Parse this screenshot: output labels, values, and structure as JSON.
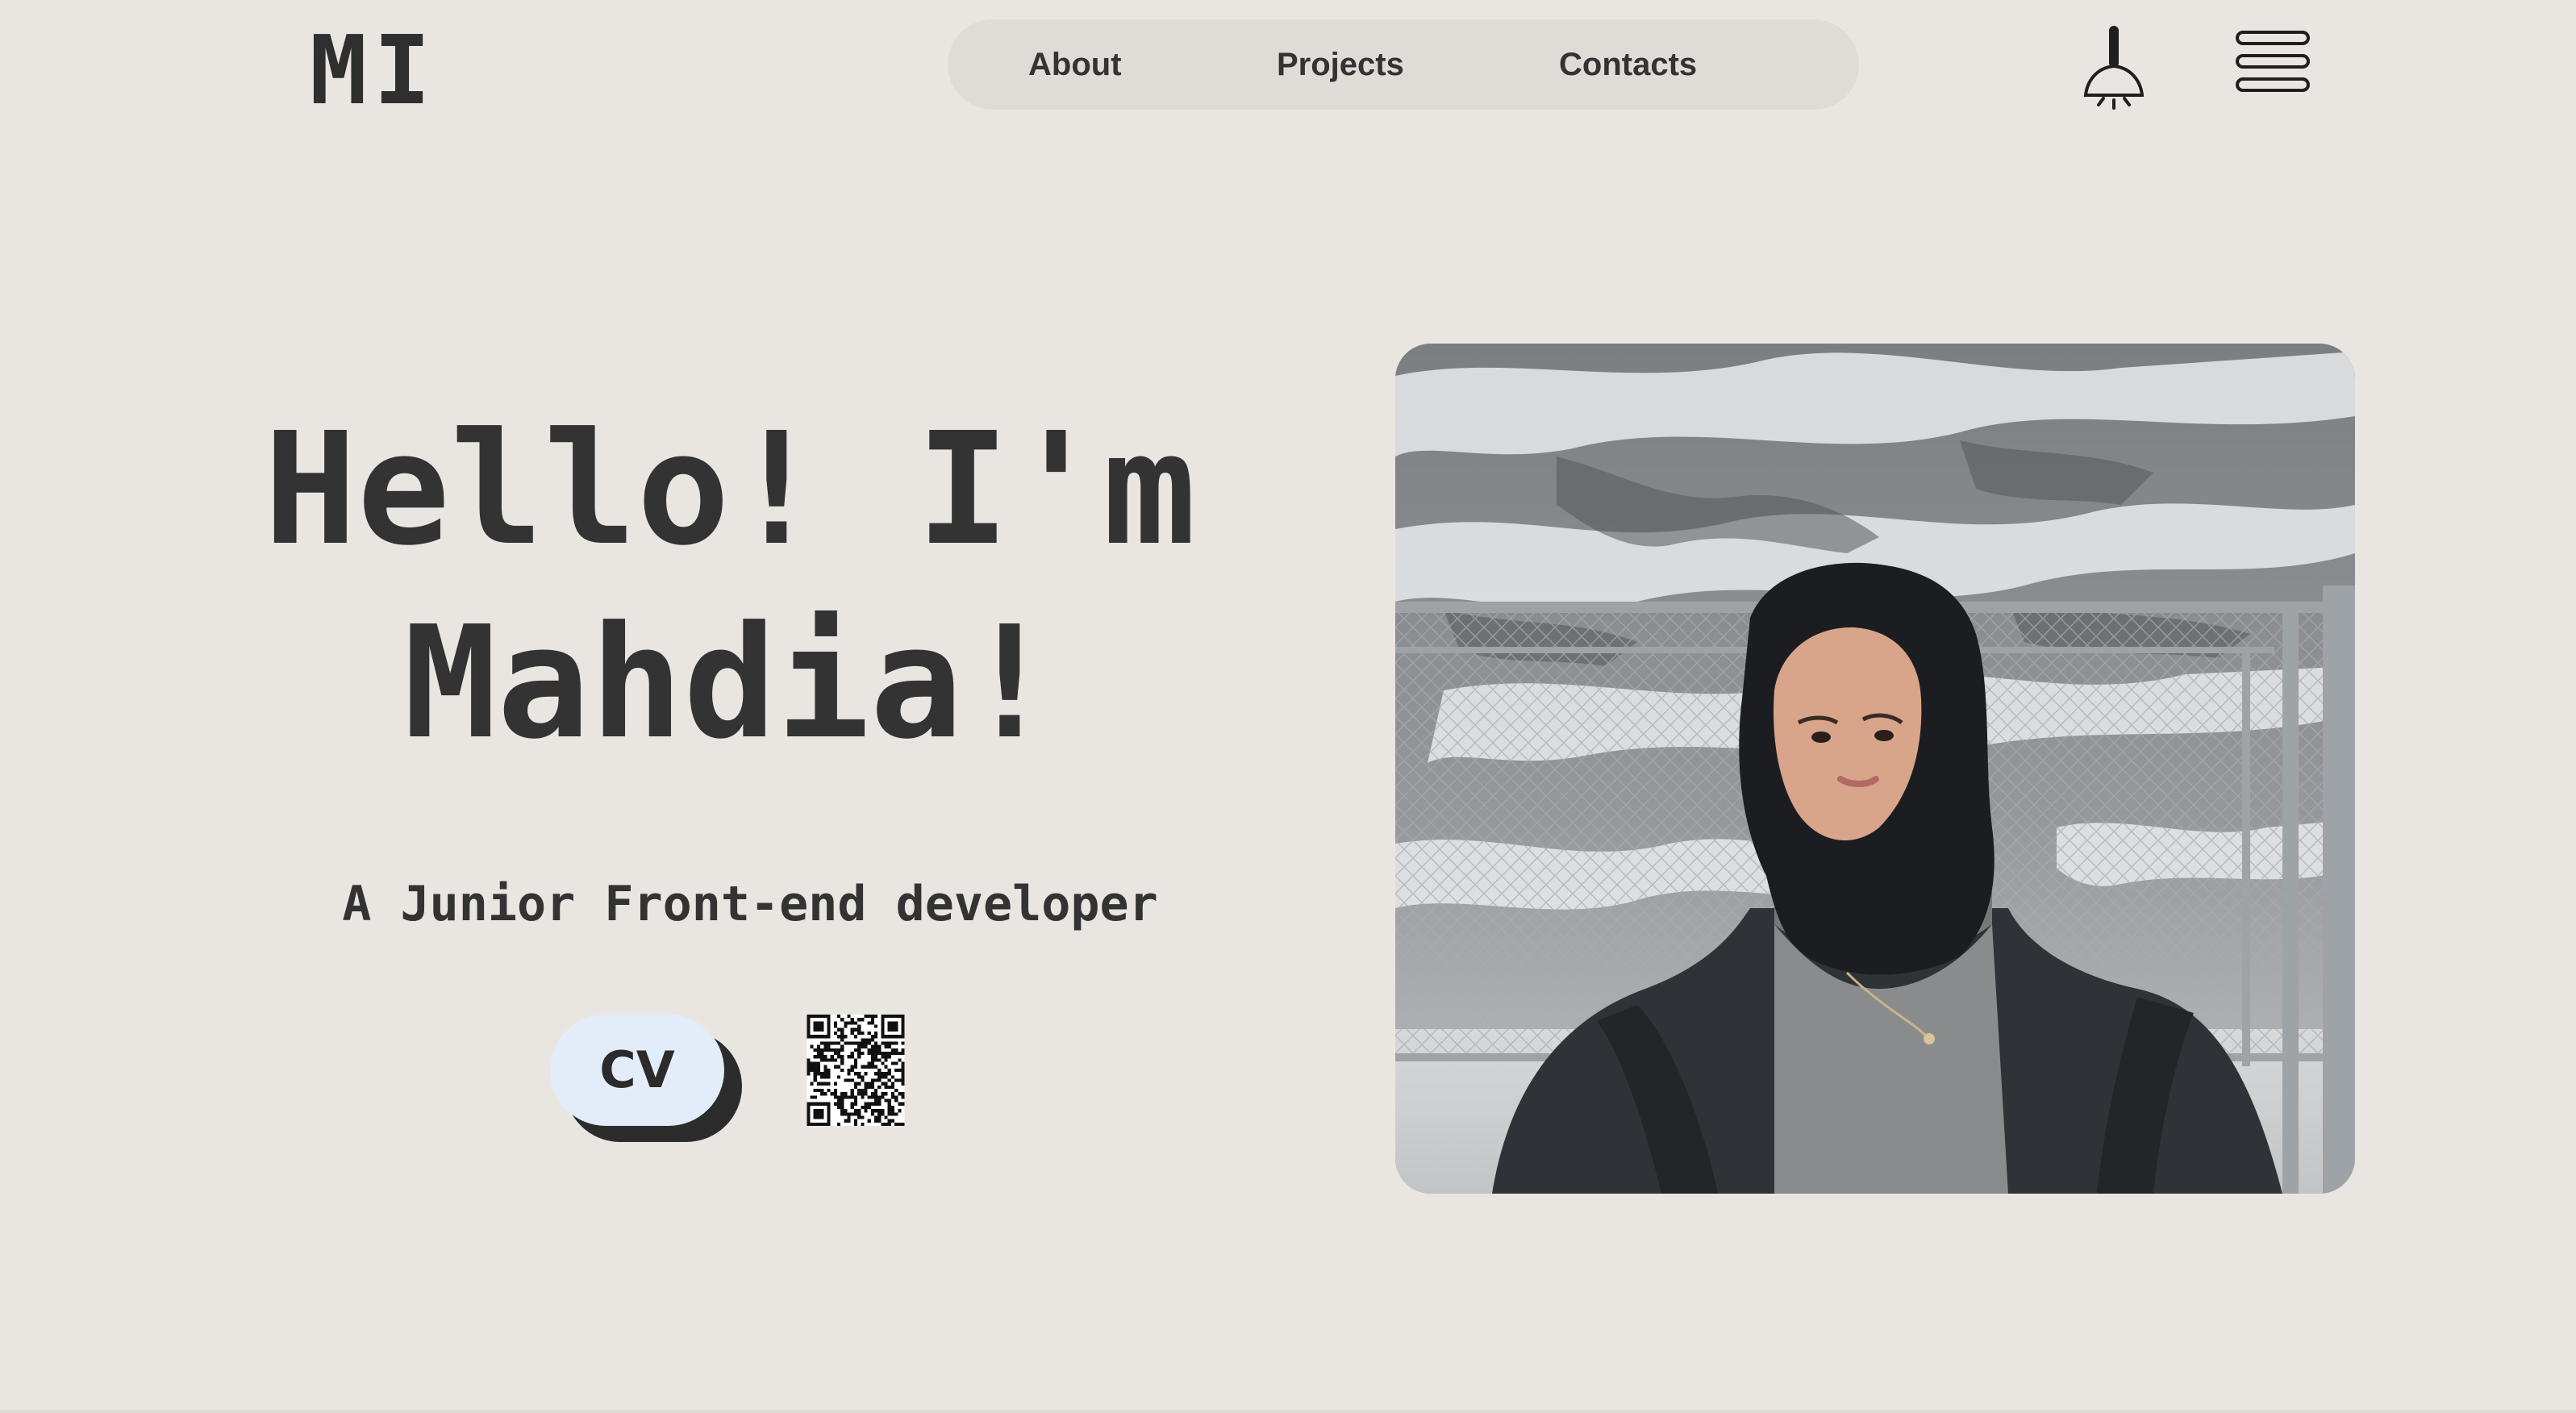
{
  "header": {
    "logo": "MI",
    "nav": [
      {
        "label": "About"
      },
      {
        "label": "Projects"
      },
      {
        "label": "Contacts"
      }
    ],
    "theme_toggle_icon": "lamp-icon",
    "menu_icon": "hamburger-menu-icon"
  },
  "hero": {
    "title_line1": "Hello! I'm",
    "title_line2": "Mahdia!",
    "subtitle": "A Junior Front-end developer",
    "cv_label": "CV",
    "qr_icon": "qr-code-icon"
  },
  "colors": {
    "background": "#e9e6e2",
    "nav_pill": "#dfdcd8",
    "cv_button": "#e2edf9",
    "text": "#333333"
  }
}
